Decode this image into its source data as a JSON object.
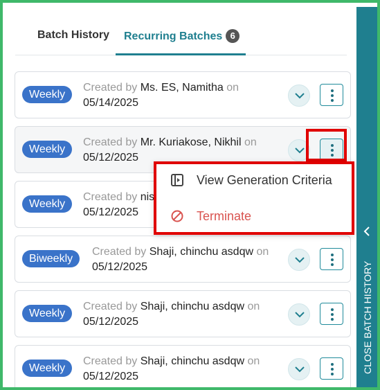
{
  "tabs": [
    {
      "label": "Batch History"
    },
    {
      "label": "Recurring Batches",
      "badge": "6"
    }
  ],
  "cards": [
    {
      "frequency": "Weekly",
      "created_by_label": "Created by",
      "author": "Ms. ES, Namitha",
      "on_label": "on",
      "date": "05/14/2025"
    },
    {
      "frequency": "Weekly",
      "created_by_label": "Created by",
      "author": "Mr. Kuriakose, Nikhil",
      "on_label": "on",
      "date": "05/12/2025"
    },
    {
      "frequency": "Weekly",
      "created_by_label": "Created by",
      "author": "nis",
      "on_label": "",
      "date": "05/12/2025"
    },
    {
      "frequency": "Biweekly",
      "created_by_label": "Created by",
      "author": "Shaji, chinchu asdqw",
      "on_label": "on",
      "date": "05/12/2025"
    },
    {
      "frequency": "Weekly",
      "created_by_label": "Created by",
      "author": "Shaji, chinchu asdqw",
      "on_label": "on",
      "date": "05/12/2025"
    },
    {
      "frequency": "Weekly",
      "created_by_label": "Created by",
      "author": "Shaji, chinchu asdqw",
      "on_label": "on",
      "date": "05/12/2025"
    }
  ],
  "menu": {
    "view_label": "View Generation Criteria",
    "terminate_label": "Terminate"
  },
  "sidebar": {
    "label": "CLOSE BATCH HISTORY"
  },
  "colors": {
    "accent": "#1f7f8f",
    "badge": "#3a73c9",
    "danger": "#d9534f",
    "highlight": "#e00000"
  },
  "icons": [
    "chevron-down-icon",
    "kebab-menu-icon",
    "view-panel-icon",
    "block-icon",
    "chevron-left-icon"
  ]
}
